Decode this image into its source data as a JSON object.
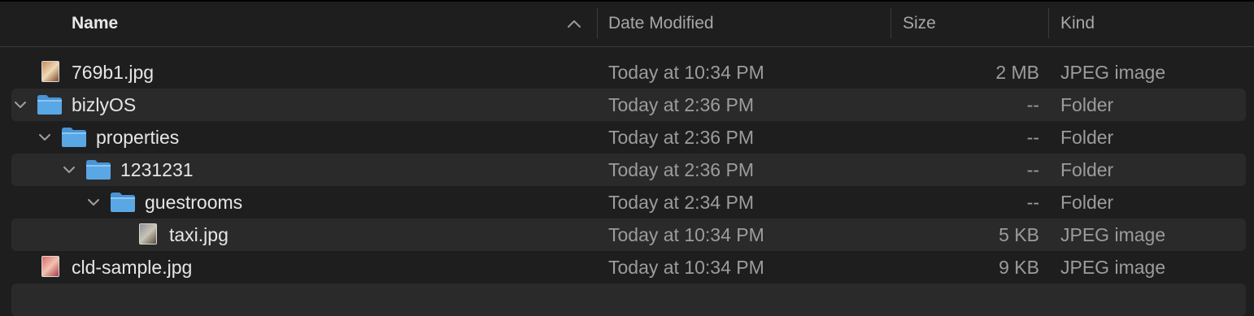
{
  "columns": {
    "name": "Name",
    "date": "Date Modified",
    "size": "Size",
    "kind": "Kind"
  },
  "rows": [
    {
      "name": "769b1.jpg",
      "date": "Today at 10:34 PM",
      "size": "2 MB",
      "kind": "JPEG image",
      "type": "image",
      "depth": 0,
      "expanded": false,
      "icon": "image-thumbnail-icon"
    },
    {
      "name": "bizlyOS",
      "date": "Today at 2:36 PM",
      "size": "--",
      "kind": "Folder",
      "type": "folder",
      "depth": 0,
      "expanded": true,
      "icon": "folder-icon"
    },
    {
      "name": "properties",
      "date": "Today at 2:36 PM",
      "size": "--",
      "kind": "Folder",
      "type": "folder",
      "depth": 1,
      "expanded": true,
      "icon": "folder-icon"
    },
    {
      "name": "1231231",
      "date": "Today at 2:36 PM",
      "size": "--",
      "kind": "Folder",
      "type": "folder",
      "depth": 2,
      "expanded": true,
      "icon": "folder-icon"
    },
    {
      "name": "guestrooms",
      "date": "Today at 2:34 PM",
      "size": "--",
      "kind": "Folder",
      "type": "folder",
      "depth": 3,
      "expanded": true,
      "icon": "folder-icon"
    },
    {
      "name": "taxi.jpg",
      "date": "Today at 10:34 PM",
      "size": "5 KB",
      "kind": "JPEG image",
      "type": "image",
      "depth": 4,
      "expanded": false,
      "icon": "image-thumbnail-icon"
    },
    {
      "name": "cld-sample.jpg",
      "date": "Today at 10:34 PM",
      "size": "9 KB",
      "kind": "JPEG image",
      "type": "image",
      "depth": 0,
      "expanded": false,
      "icon": "image-thumbnail-icon"
    }
  ],
  "sort": {
    "column": "name",
    "direction": "ascending",
    "icon": "chevron-up-icon"
  },
  "colors": {
    "background": "#1e1e1e",
    "alt_row": "#2a2a2a",
    "folder_blue": "#5aa7e6"
  }
}
